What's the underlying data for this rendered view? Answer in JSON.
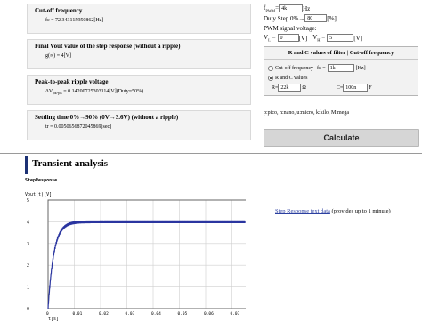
{
  "results": [
    {
      "title": "Cut-off frequency",
      "value": "fc = 72.343115950862[Hz]"
    },
    {
      "title": "Final Vout value of the step response (without a ripple)",
      "value": "g(∞) = 4[V]"
    },
    {
      "title": "Peak-to-peak ripple voltage",
      "value_prefix": "ΔV",
      "value_sub": "pk-pk",
      "value_rest": " = 0.14200725303114[V](Duty=50%)"
    },
    {
      "title": "Settling time 0%→90% (0V→3.6V) (without a ripple)",
      "value": "tr = 0.0050656872045869[sec]"
    }
  ],
  "inputs": {
    "fpwm_label": "f",
    "fpwm_sub": "PWM",
    "fpwm_eq": "=",
    "fpwm_value": "4k",
    "fpwm_unit": "Hz",
    "duty_label": "Duty Step  0%→",
    "duty_value": "80",
    "duty_unit": "[%]",
    "pwm_voltage_label": "PWM signal voltage:",
    "vl_label": "V",
    "vl_sub": "L",
    "vl_eq": " =",
    "vl_value": "0",
    "vl_unit": "[V]",
    "vh_label": "V",
    "vh_sub": "H",
    "vh_eq": " =",
    "vh_value": "5",
    "vh_unit": "[V]"
  },
  "filter": {
    "header": "R and C values of filter | Cut-off frequency",
    "opt1_label": "Cut-off frequency",
    "fc_label": "fc =",
    "fc_value": "1k",
    "fc_unit": "[Hz]",
    "opt2_label": "R and C values",
    "r_label": "R=",
    "r_value": "22k",
    "r_unit": "Ω",
    "c_label": "C=",
    "c_value": "100n",
    "c_unit": "F",
    "selected": "rc"
  },
  "units_note": "p:pico, n:nano, u:micro, k:kilo, M:mega",
  "calculate_label": "Calculate",
  "section_title": "Transient analysis",
  "link_text": "Step Response text data",
  "link_note": " (provides up to 1 minute)",
  "chart_data": {
    "type": "line",
    "title": "StepResponse",
    "ylabel": "Vout(t)[V]",
    "xlabel": "t[s]",
    "xlim": [
      0,
      0.08
    ],
    "ylim": [
      0,
      5
    ],
    "xticks": [
      "0",
      "0.01",
      "0.02",
      "0.03",
      "0.04",
      "0.05",
      "0.06",
      "0.07"
    ],
    "yticks": [
      "0",
      "1",
      "2",
      "3",
      "4",
      "5"
    ],
    "grid": true,
    "series": [
      {
        "color": "#2a35a0",
        "tau": 0.0022,
        "final": 4,
        "ripple_pp": 0.142,
        "t_end": 0.075
      }
    ]
  }
}
